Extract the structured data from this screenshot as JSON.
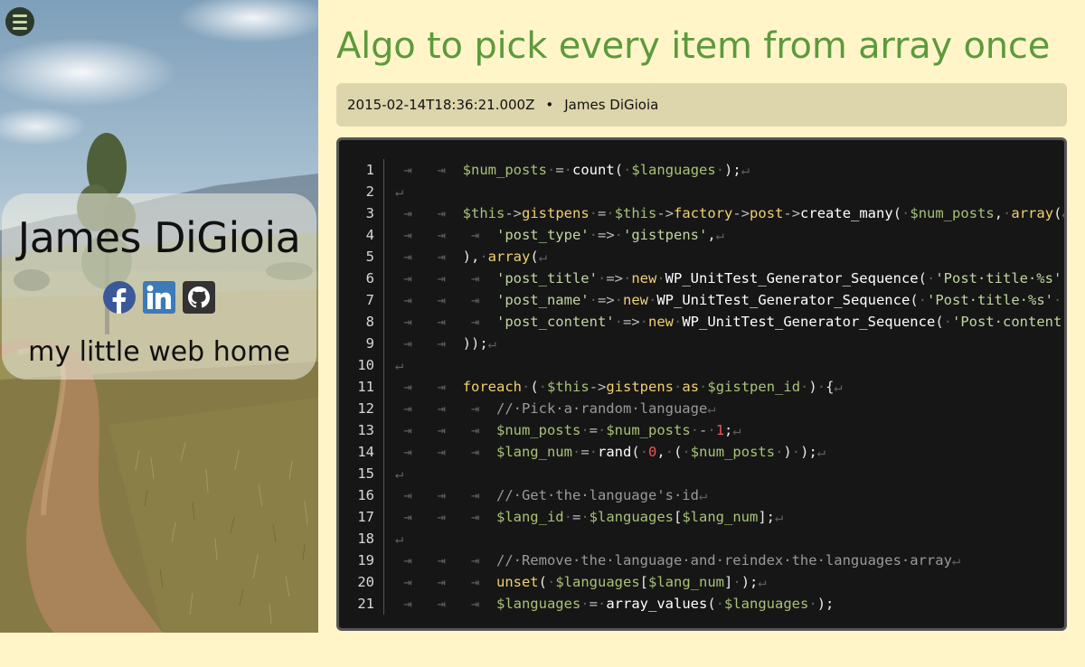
{
  "sidebar": {
    "menu_icon": "hamburger-menu-icon",
    "profile_name": "James DiGioia",
    "tagline": "my little web home",
    "social": [
      {
        "name": "facebook",
        "icon": "facebook-icon",
        "color": "#3b5998"
      },
      {
        "name": "linkedin",
        "icon": "linkedin-icon",
        "color": "#3d7ab8"
      },
      {
        "name": "github",
        "icon": "github-icon",
        "color": "#333333"
      }
    ]
  },
  "post": {
    "title": "Algo to pick every item from array once",
    "date": "2015-02-14T18:36:21.000Z",
    "separator": "•",
    "author": "James DiGioia"
  },
  "colors": {
    "background": "#fff5c8",
    "title": "#5c9a3c",
    "meta_bar": "#ddd5ab",
    "code_bg": "#161616"
  },
  "code": {
    "language": "php",
    "lines": [
      {
        "n": "1",
        "text": "\t\t$num_posts = count( $languages );"
      },
      {
        "n": "2",
        "text": ""
      },
      {
        "n": "3",
        "text": "\t\t$this->gistpens = $this->factory->post->create_many( $num_posts, array("
      },
      {
        "n": "4",
        "text": "\t\t\t'post_type' => 'gistpens',"
      },
      {
        "n": "5",
        "text": "\t\t), array("
      },
      {
        "n": "6",
        "text": "\t\t\t'post_title' => new WP_UnitTest_Generator_Sequence( 'Post title %s' ),"
      },
      {
        "n": "7",
        "text": "\t\t\t'post_name' => new WP_UnitTest_Generator_Sequence( 'Post title %s' ),"
      },
      {
        "n": "8",
        "text": "\t\t\t'post_content' => new WP_UnitTest_Generator_Sequence( 'Post content %s' ),"
      },
      {
        "n": "9",
        "text": "\t\t));"
      },
      {
        "n": "10",
        "text": ""
      },
      {
        "n": "11",
        "text": "\t\tforeach ( $this->gistpens as $gistpen_id ) {"
      },
      {
        "n": "12",
        "text": "\t\t\t// Pick a random language"
      },
      {
        "n": "13",
        "text": "\t\t\t$num_posts = $num_posts - 1;"
      },
      {
        "n": "14",
        "text": "\t\t\t$lang_num = rand( 0, ( $num_posts ) );"
      },
      {
        "n": "15",
        "text": ""
      },
      {
        "n": "16",
        "text": "\t\t\t// Get the language's id"
      },
      {
        "n": "17",
        "text": "\t\t\t$lang_id = $languages[$lang_num];"
      },
      {
        "n": "18",
        "text": ""
      },
      {
        "n": "19",
        "text": "\t\t\t// Remove the language and reindex the languages array"
      },
      {
        "n": "20",
        "text": "\t\t\tunset( $languages[$lang_num] );"
      },
      {
        "n": "21",
        "text": "\t\t\t$languages = array_values( $languages );",
        "no_eol": true
      }
    ]
  }
}
